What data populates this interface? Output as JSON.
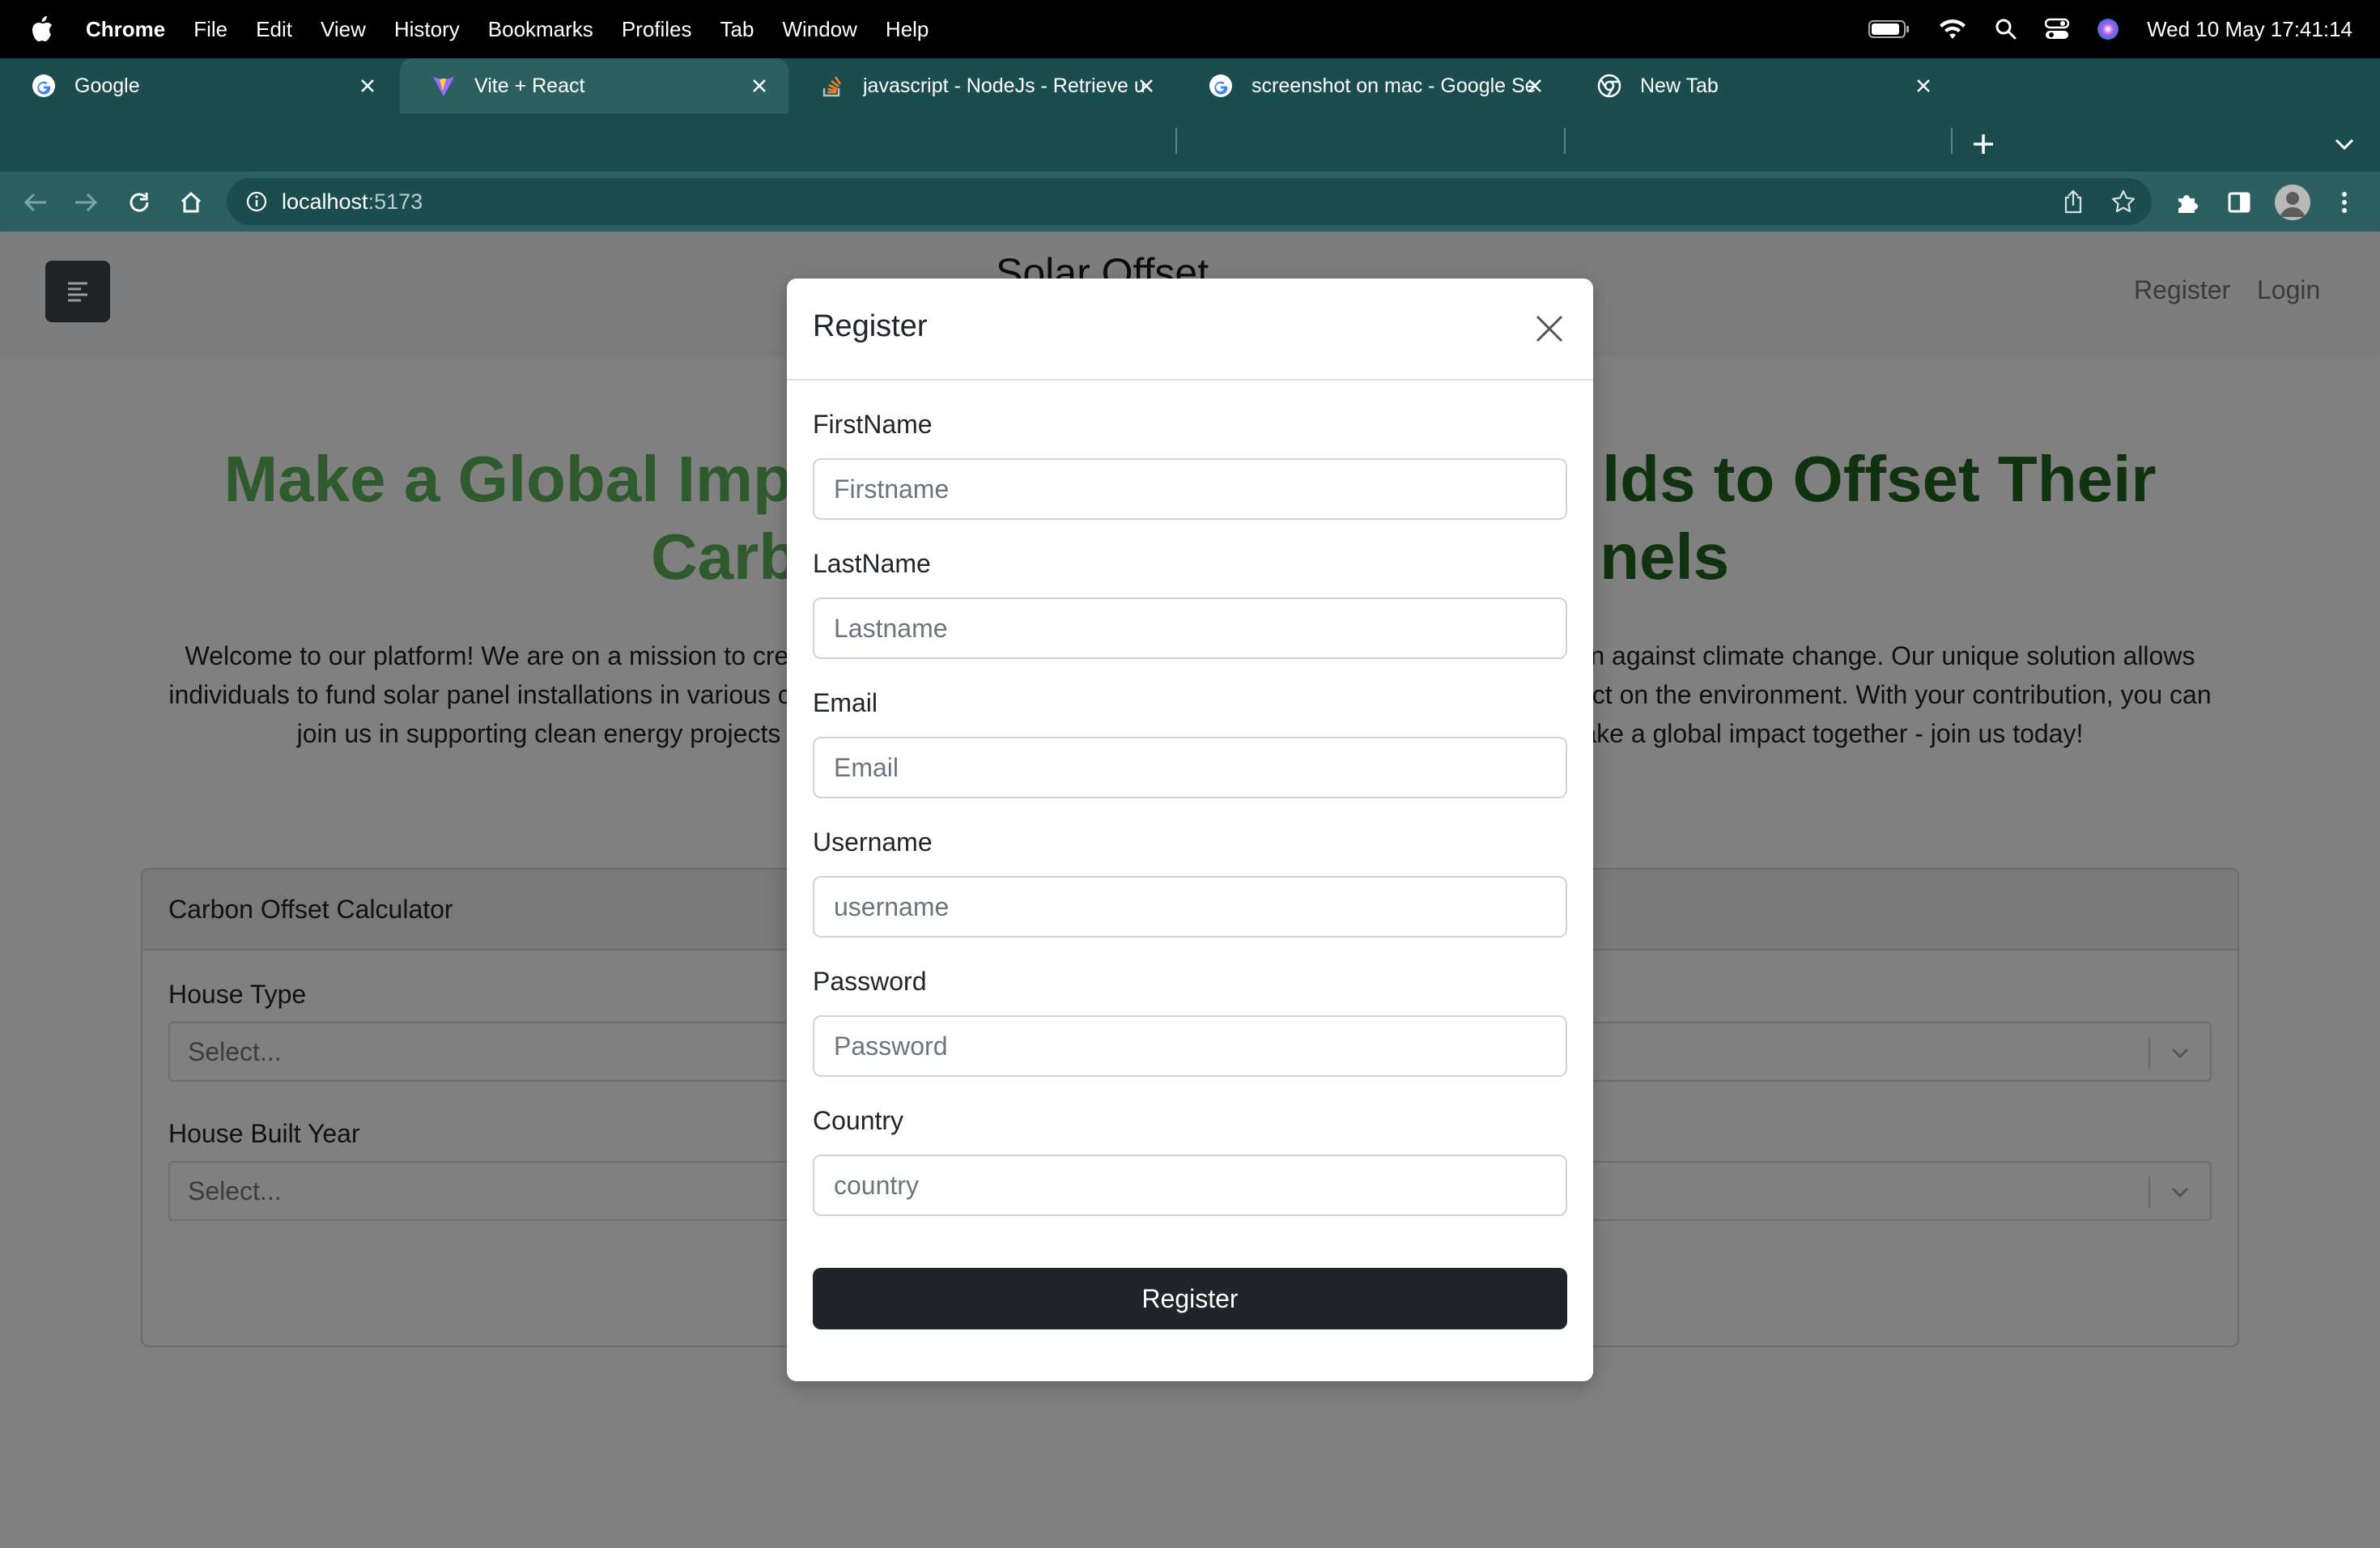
{
  "menubar": {
    "app_name": "Chrome",
    "items": [
      "File",
      "Edit",
      "View",
      "History",
      "Bookmarks",
      "Profiles",
      "Tab",
      "Window",
      "Help"
    ],
    "datetime": "Wed 10 May  17:41:14"
  },
  "browser": {
    "tabs": [
      {
        "title": "Google",
        "icon": "google-icon"
      },
      {
        "title": "Vite + React",
        "icon": "vite-icon"
      },
      {
        "title": "javascript - NodeJs - Retrieve u",
        "icon": "stackoverflow-icon"
      },
      {
        "title": "screenshot on mac - Google Se",
        "icon": "google-icon"
      },
      {
        "title": "New Tab",
        "icon": "chrome-icon"
      }
    ],
    "active_tab": 1,
    "address": {
      "host": "localhost",
      "port": ":5173"
    }
  },
  "page": {
    "brand": "Solar Offset",
    "nav_links": {
      "register": "Register",
      "login": "Login"
    },
    "hero_line1_left": "Make a Global Imp",
    "hero_line1_right": "lds to Offset Their",
    "hero_line2_left": "Carb",
    "hero_line2_right": "nels",
    "intro_line1_left": "Welcome to our platform! We are on a mission to cre",
    "intro_line1_right": "n against climate change. Our unique solution allows",
    "intro_line2_left": "individuals to fund solar panel installations in various c",
    "intro_line2_right": "ct on the environment. With your contribution, you can",
    "intro_line3_left": "join us in supporting clean energy projects",
    "intro_line3_right": "ake a global impact together - join us today!",
    "calculator": {
      "title": "Carbon Offset Calculator",
      "house_type_label": "House Type",
      "house_type_placeholder": "Select...",
      "built_year_label": "House Built Year",
      "built_year_placeholder": "Select..."
    }
  },
  "modal": {
    "title": "Register",
    "fields": [
      {
        "label": "FirstName",
        "placeholder": "Firstname"
      },
      {
        "label": "LastName",
        "placeholder": "Lastname"
      },
      {
        "label": "Email",
        "placeholder": "Email"
      },
      {
        "label": "Username",
        "placeholder": "username"
      },
      {
        "label": "Password",
        "placeholder": "Password"
      },
      {
        "label": "Country",
        "placeholder": "country"
      }
    ],
    "submit_label": "Register"
  }
}
